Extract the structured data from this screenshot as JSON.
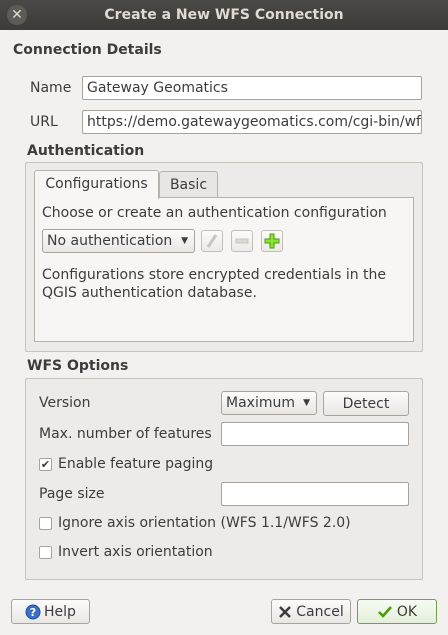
{
  "window": {
    "title": "Create a New WFS Connection"
  },
  "connection": {
    "section_title": "Connection Details",
    "name_label": "Name",
    "name_value": "Gateway Geomatics",
    "url_label": "URL",
    "url_value": "https://demo.gatewaygeomatics.com/cgi-bin/wfs_"
  },
  "authentication": {
    "section_title": "Authentication",
    "tabs": [
      "Configurations",
      "Basic"
    ],
    "instruction": "Choose or create an authentication configuration",
    "selected": "No authentication",
    "note": "Configurations store encrypted credentials in the QGIS authentication database."
  },
  "wfs_options": {
    "section_title": "WFS Options",
    "version_label": "Version",
    "version_value": "Maximum",
    "detect_label": "Detect",
    "max_features_label": "Max. number of features",
    "max_features_value": "",
    "paging_label": "Enable feature paging",
    "paging_checked": true,
    "page_size_label": "Page size",
    "page_size_value": "",
    "ignore_axis_label": "Ignore axis orientation (WFS 1.1/WFS 2.0)",
    "ignore_axis_checked": false,
    "invert_axis_label": "Invert axis orientation",
    "invert_axis_checked": false
  },
  "buttons": {
    "help": "Help",
    "cancel": "Cancel",
    "ok": "OK"
  },
  "colors": {
    "titlebar": "#3c3b37",
    "ok_border": "#6fa34a",
    "add_green": "#4e9a06"
  }
}
